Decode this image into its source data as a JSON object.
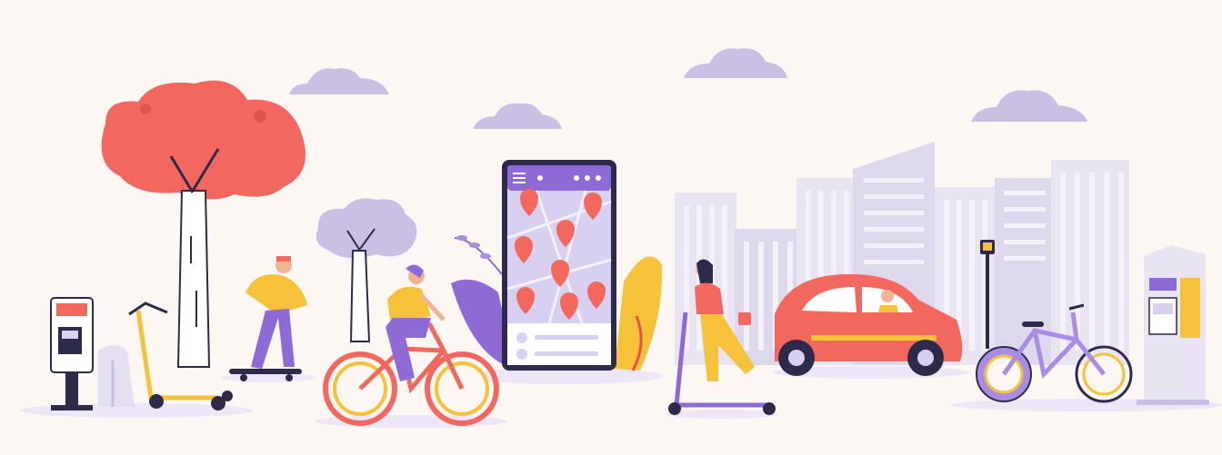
{
  "scene": {
    "palette": {
      "background": "#fdf7f4",
      "cloud": "#c9c0e4",
      "building_light": "#e8e4f2",
      "building_mid": "#ddd8ec",
      "window": "#f4f1fa",
      "coral": "#f2685e",
      "coral_dark": "#e0544b",
      "purple": "#8d6ad6",
      "purple_light": "#a98de4",
      "purple_soft": "#d8d0f0",
      "yellow": "#f5c23a",
      "yellow_dark": "#e4ab25",
      "dark": "#2e2a4a",
      "white": "#ffffff",
      "ground": "#ece6f6",
      "skin": "#f2b392"
    },
    "icons": [
      "cloud-icon",
      "tree-icon",
      "building-icon",
      "smartphone-map-icon",
      "map-pin-icon",
      "scooter-icon",
      "bicycle-icon",
      "car-icon",
      "skateboard-icon",
      "charging-station-icon",
      "street-lamp-icon"
    ]
  }
}
